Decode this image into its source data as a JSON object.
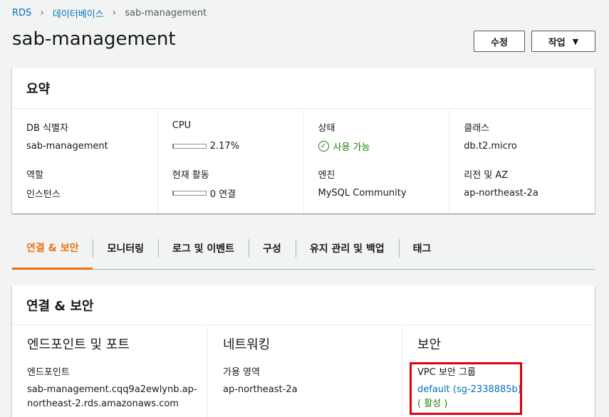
{
  "breadcrumb": {
    "items": [
      "RDS",
      "데이터베이스"
    ],
    "current": "sab-management"
  },
  "page": {
    "title": "sab-management",
    "edit_label": "수정",
    "actions_label": "작업"
  },
  "summary": {
    "title": "요약",
    "db_id_label": "DB 식별자",
    "db_id_value": "sab-management",
    "role_label": "역할",
    "role_value": "인스턴스",
    "cpu_label": "CPU",
    "cpu_value": "2.17%",
    "cpu_fraction": 0.0217,
    "activity_label": "현재 활동",
    "activity_value": "0 연결",
    "activity_fraction": 0.0,
    "status_label": "상태",
    "status_value": "사용 가능",
    "engine_label": "엔진",
    "engine_value": "MySQL Community",
    "class_label": "클래스",
    "class_value": "db.t2.micro",
    "region_label": "리전 및 AZ",
    "region_value": "ap-northeast-2a"
  },
  "tabs": [
    "연결 & 보안",
    "모니터링",
    "로그 및 이벤트",
    "구성",
    "유지 관리 및 백업",
    "태그"
  ],
  "connection": {
    "title": "연결 & 보안",
    "endpoint_section": "엔드포인트 및 포트",
    "endpoint_label": "엔드포인트",
    "endpoint_value": "sab-management.cqq9a2ewlynb.ap-northeast-2.rds.amazonaws.com",
    "network_section": "네트워킹",
    "az_label": "가용 영역",
    "az_value": "ap-northeast-2a",
    "security_section": "보안",
    "sg_label": "VPC 보안 그룹",
    "sg_link": "default (sg-2338885b)",
    "sg_status": "( 활성 )"
  },
  "colors": {
    "accent": "#ec7211",
    "link": "#0073bb",
    "success": "#1d8102",
    "highlight": "#e00010"
  }
}
